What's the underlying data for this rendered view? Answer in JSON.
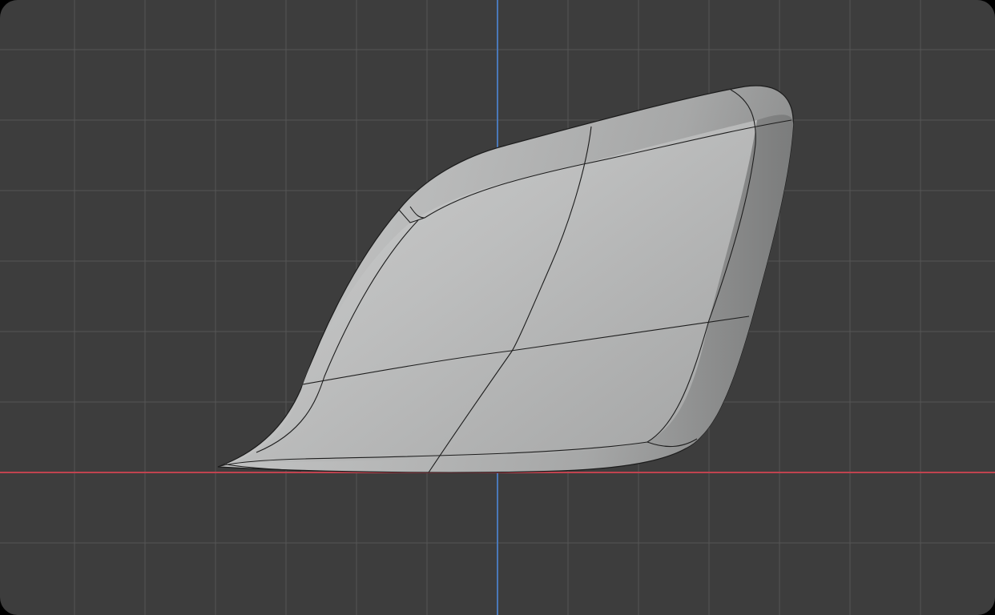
{
  "viewport": {
    "view": "orthographic-side",
    "background_color": "#3d3d3d",
    "grid_color": "#545454",
    "x_axis_color": "#c0434f",
    "z_axis_color": "#4a78b8",
    "mesh_color": "#b4b5b5",
    "wire_color": "#1c1c1c",
    "object": "subdivided-curved-panel",
    "shading": "solid",
    "overlays": {
      "grid": true,
      "wireframe_edges": true
    }
  }
}
